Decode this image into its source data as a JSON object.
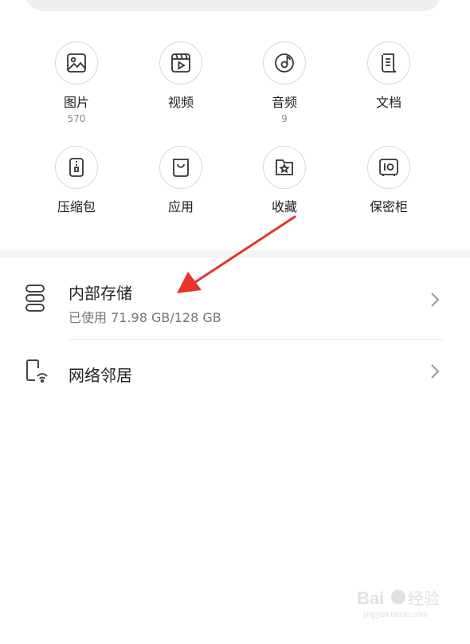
{
  "categories": [
    {
      "label": "图片",
      "count": "570",
      "icon": "image-icon"
    },
    {
      "label": "视频",
      "count": "",
      "icon": "video-icon"
    },
    {
      "label": "音频",
      "count": "9",
      "icon": "music-icon"
    },
    {
      "label": "文档",
      "count": "",
      "icon": "document-icon"
    },
    {
      "label": "压缩包",
      "count": "",
      "icon": "archive-icon"
    },
    {
      "label": "应用",
      "count": "",
      "icon": "app-bag-icon"
    },
    {
      "label": "收藏",
      "count": "",
      "icon": "favorites-star-icon"
    },
    {
      "label": "保密柜",
      "count": "",
      "icon": "safe-icon"
    }
  ],
  "storage": {
    "title": "内部存储",
    "usage": "已使用 71.98 GB/128 GB",
    "icon": "storage-icon"
  },
  "network": {
    "title": "网络邻居",
    "icon": "network-device-icon"
  },
  "colors": {
    "annotation_arrow": "#e8342c",
    "icon_stroke": "#333333"
  }
}
